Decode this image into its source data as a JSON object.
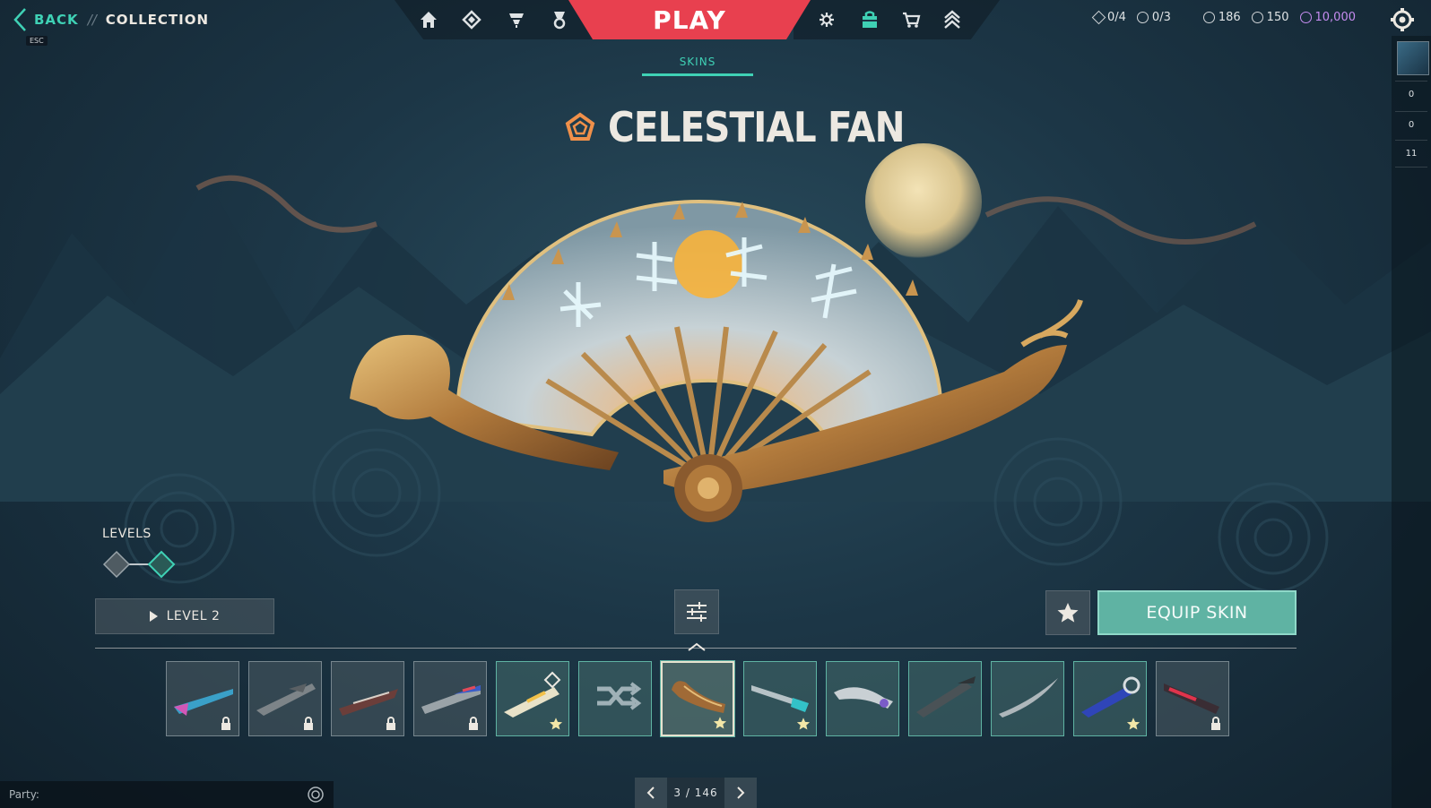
{
  "header": {
    "back_label": "BACK",
    "separator": "//",
    "breadcrumb": "COLLECTION",
    "esc_hint": "ESC",
    "play_label": "PLAY",
    "nav_left_icons": [
      "home-icon",
      "agents-icon",
      "career-icon",
      "battlepass-icon"
    ],
    "nav_right_icons": [
      "social-icon",
      "collection-icon",
      "store-icon",
      "rank-icon"
    ]
  },
  "currencies": {
    "free_agents": "0/4",
    "kingdom_credits_badge": "0/3",
    "valorant_points": "186",
    "radianite": "150",
    "kingdom_credits": "10,000"
  },
  "right_rail": {
    "counts": [
      "0",
      "0",
      "11"
    ]
  },
  "tab": {
    "label": "SKINS"
  },
  "skin": {
    "name": "CELESTIAL FAN"
  },
  "levels": {
    "label": "LEVELS",
    "button_label": "LEVEL 2",
    "total": 2,
    "current": 2
  },
  "actions": {
    "equip_label": "EQUIP SKIN"
  },
  "strip": {
    "cards": [
      {
        "id": "skin-1",
        "state": "locked"
      },
      {
        "id": "skin-2",
        "state": "locked"
      },
      {
        "id": "skin-3",
        "state": "locked"
      },
      {
        "id": "skin-4",
        "state": "locked"
      },
      {
        "id": "skin-5",
        "state": "favorite"
      },
      {
        "id": "skin-6",
        "state": "random"
      },
      {
        "id": "skin-7",
        "state": "selected"
      },
      {
        "id": "skin-8",
        "state": "favorite"
      },
      {
        "id": "skin-9",
        "state": "owned"
      },
      {
        "id": "skin-10",
        "state": "owned"
      },
      {
        "id": "skin-11",
        "state": "owned"
      },
      {
        "id": "skin-12",
        "state": "favorite"
      },
      {
        "id": "skin-13",
        "state": "locked"
      }
    ]
  },
  "pagination": {
    "label": "3 / 146"
  },
  "party": {
    "label": "Party:"
  },
  "colors": {
    "accent": "#3fd1b5",
    "play": "#e8404f",
    "equip": "#5fb3a3",
    "tier": "#f0904a"
  }
}
